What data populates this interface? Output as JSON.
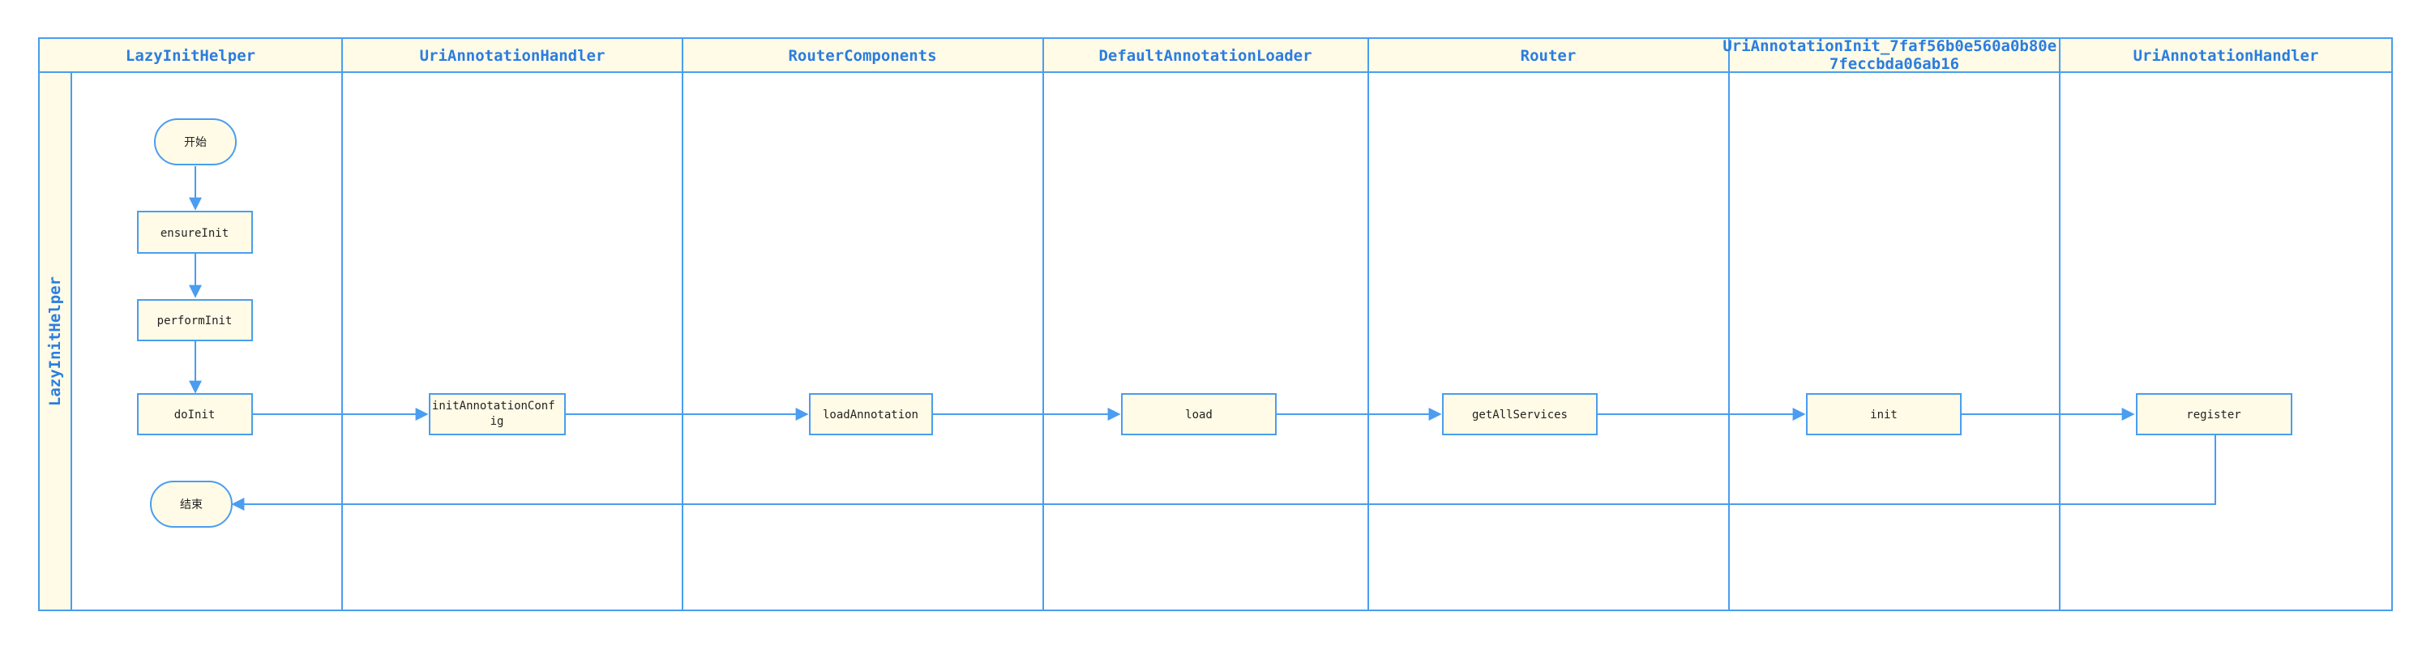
{
  "pool": {
    "title": "LazyInitHelper"
  },
  "lanes": [
    {
      "title": "LazyInitHelper"
    },
    {
      "title": "UriAnnotationHandler"
    },
    {
      "title": "RouterComponents"
    },
    {
      "title": "DefaultAnnotationLoader"
    },
    {
      "title": "Router"
    },
    {
      "title": "UriAnnotationInit_7faf56b0e560a0b80e7feccbda06ab16"
    },
    {
      "title": "UriAnnotationHandler"
    }
  ],
  "nodes": {
    "start": "开始",
    "ensure_init": "ensureInit",
    "perform_init": "performInit",
    "do_init": "doInit",
    "init_annotation_config": "initAnnotationConfig",
    "load_annotation": "loadAnnotation",
    "load": "load",
    "get_all_services": "getAllServices",
    "init": "init",
    "register": "register",
    "end": "结束"
  },
  "colors": {
    "line": "#4a9df0",
    "fill": "#fffbe6",
    "title_text": "#2a7de1"
  }
}
